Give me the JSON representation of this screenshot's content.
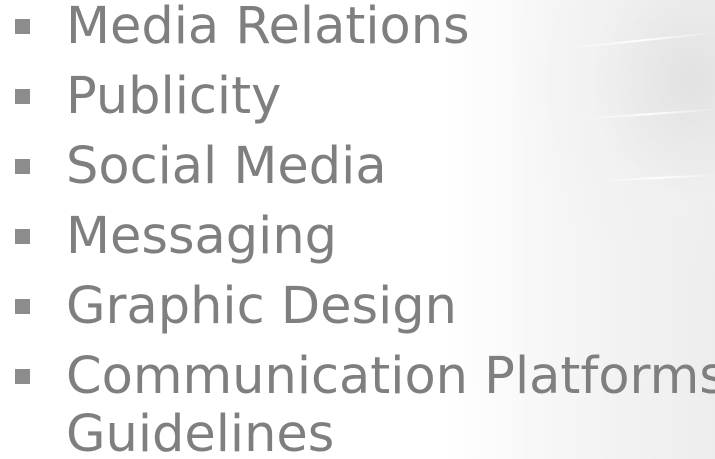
{
  "slide": {
    "bullets": [
      {
        "label": "Media Relations"
      },
      {
        "label": "Publicity"
      },
      {
        "label": "Social Media"
      },
      {
        "label": "Messaging"
      },
      {
        "label": "Graphic Design"
      },
      {
        "label": "Communication Platforms/",
        "continuation": "Guidelines"
      }
    ]
  },
  "colors": {
    "text": "#7f7f7f",
    "bullet": "#8c8c8c",
    "background": "#ffffff"
  }
}
